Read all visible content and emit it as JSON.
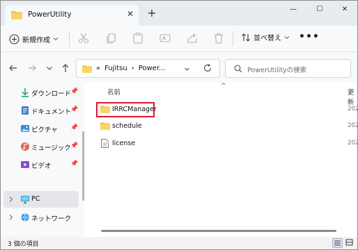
{
  "window": {
    "tab_title": "PowerUtility",
    "tab_close": "✕",
    "new_tab": "+",
    "minimize": "—",
    "maximize": "☐",
    "close": "✕"
  },
  "command_bar": {
    "new_label": "新規作成",
    "sort_label": "並べ替え",
    "more": "•••"
  },
  "address_bar": {
    "overflow": "«",
    "crumbs": [
      "Fujitsu",
      "›",
      "Power..."
    ],
    "search_placeholder": "PowerUtilityの検索"
  },
  "nav_pane": {
    "quick_access": [
      {
        "label": "ダウンロード",
        "icon": "download-icon"
      },
      {
        "label": "ドキュメント",
        "icon": "document-icon"
      },
      {
        "label": "ピクチャ",
        "icon": "pictures-icon"
      },
      {
        "label": "ミュージック",
        "icon": "music-icon"
      },
      {
        "label": "ビデオ",
        "icon": "video-icon"
      }
    ],
    "pin_glyph": "📌",
    "pc_label": "PC",
    "network_label": "ネットワーク"
  },
  "content": {
    "col_name": "名前",
    "col_date": "更新",
    "sort_arrow": "^",
    "rows": [
      {
        "name": "IRRCManager",
        "type": "folder",
        "date": "202"
      },
      {
        "name": "schedule",
        "type": "folder",
        "date": "202"
      },
      {
        "name": "license",
        "type": "file",
        "date": "202"
      }
    ]
  },
  "status_bar": {
    "count_text": "3 個の項目"
  },
  "colors": {
    "folder": "#f2c44d",
    "highlight_border": "#e0142b",
    "accent_blue": "#1a73c9"
  }
}
